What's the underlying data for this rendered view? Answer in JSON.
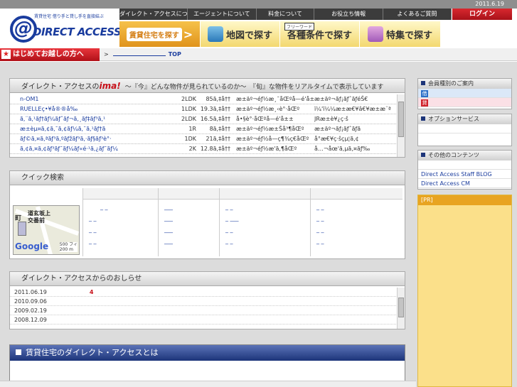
{
  "topbar": {
    "date": "2011.6.19"
  },
  "header": {
    "logo": {
      "tagline": "賃貸住宅 借り手と貸し手を直接結ぶ",
      "at_symbol": "@",
      "name": "DIRECT ACCESS"
    },
    "nav": [
      "ダイレクト・アクセスについて",
      "エージェントについて",
      "料金について",
      "お役立ち情報",
      "よくあるご質問"
    ],
    "login_label": "ログイン",
    "search_buttons": {
      "rent_search": "賃貸住宅を探す",
      "rent_arrow": ">",
      "map": "地図で探す",
      "freeword_tag": "フリーワード",
      "conditions": "各種条件で探す",
      "special": "特集で探す"
    }
  },
  "welcome": {
    "first_visit": "はじめてお越しの方へ",
    "star": "★",
    "crumb_prefix": ">",
    "crumb_top": "TOP"
  },
  "ima": {
    "title_prefix": "ダイレクト・アクセスの",
    "title_ima": "ima!",
    "subtitle": "～『今』どんな物件が見られているのか～　『旬』な物件をリアルタイムで表示しています",
    "rows": [
      {
        "name": "n-OM1",
        "layout": "2LDK",
        "area": "85ã,‡å††",
        "addr": "æ±äº¬éƒ½æ¸¯åŒºå—é'å±±",
        "info": "æ±äº¬ãƒ¡ãƒˆãƒ­éŠ€"
      },
      {
        "name": "RUELLEç•¥å®®å‰",
        "layout": "1LDK",
        "area": "19.3ã,‡å††",
        "addr": "æ±äº¬éƒ½æ¸‹è°·åŒº",
        "info": "ï¼'ï¼¼æ±æ€¥â€¥æ±æ¨ª"
      },
      {
        "name": "ã,¨ã,¹ãƒ†ãƒ¼ãƒˆãƒ¬ã,¸ãƒ‡ãƒ³ã,¹",
        "layout": "2LDK",
        "area": "16.5ã,‡å††",
        "addr": "å•§è°·åŒºå—é'å±±",
        "info": "JRæ±è¥¿ç·š"
      },
      {
        "name": "æ±èµ¤ã,¢ã,¯ã,¢ãƒ¼ã,¯ã,¹ãƒ†ã",
        "layout": "1R",
        "area": "8ã,‡å††",
        "addr": "æ±äº¬éƒ½æ±Šå³¶åŒº",
        "info": "æ±äº¬ãƒ¡ãƒˆãƒ­ã"
      },
      {
        "name": "ãƒ©ã,¤ã,ªãƒ³ã,ºãƒžãƒ³ã,·ãƒ§ãƒ³è°·",
        "layout": "1DK",
        "area": "21ã,‡å††",
        "addr": "æ±äº¬éƒ½å—ç¶¾ç€åŒº",
        "info": "å°æ€¥ç·šçµ¦ã,¢"
      },
      {
        "name": "ã,¢ã,¤ã,¢ãƒ³ãƒ¯ãƒ¼ãƒ«é·¹ã,¿ãƒ¯ãƒ¼",
        "layout": "2K",
        "area": "12.8ã,‡å††",
        "addr": "æ±äº¬éƒ½æ'ã,¶åŒº",
        "info": "å…¬åœ'ã,µã,¤ãƒ‰"
      }
    ]
  },
  "quick": {
    "title": "クイック検索",
    "map": {
      "label_line1": "道玄坂上",
      "label_line2": "交番前",
      "google": "Google",
      "scale_ft": "500 フィ",
      "scale_m": "200 m",
      "town": "町"
    },
    "columns": [
      {
        "links": [
          "_ _",
          "_ _",
          "_ _",
          "_ _"
        ]
      },
      {
        "links": [
          "___",
          "___",
          "___",
          "___"
        ]
      },
      {
        "links": [
          "_ _",
          "_ ___",
          "_ _",
          "_ _"
        ]
      },
      {
        "links": [
          "_ _",
          "_ _",
          "_ _",
          "_ _"
        ]
      }
    ]
  },
  "news": {
    "title": "ダイレクト・アクセスからのおしらせ",
    "items": [
      {
        "date": "2011.06.19",
        "count": "4"
      },
      {
        "date": "2010.09.06",
        "count": ""
      },
      {
        "date": "2009.02.19",
        "count": ""
      },
      {
        "date": "2008.12.09",
        "count": ""
      }
    ]
  },
  "about": {
    "title": "賃貸住宅のダイレクト・アクセスとは"
  },
  "sidebar": {
    "members": {
      "title": "会員種別のご案内",
      "items": [
        {
          "badge": "借",
          "color": "#2b6fc8"
        },
        {
          "badge": "貸",
          "color": "#d0222b"
        }
      ]
    },
    "options": {
      "title": "オプションサービス"
    },
    "others": {
      "title": "その他のコンテンツ",
      "items": [
        "Direct Access Staff BLOG",
        "Direct Access CM"
      ]
    },
    "pr": "[PR]"
  }
}
